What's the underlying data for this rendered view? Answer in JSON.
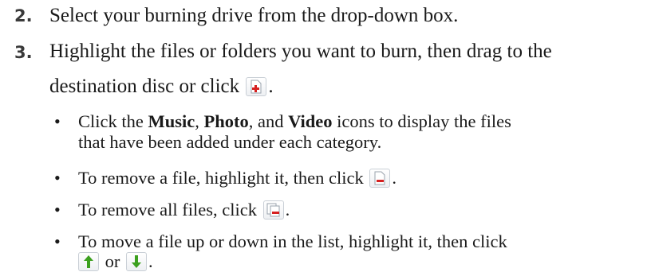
{
  "steps": [
    {
      "number": "2.",
      "text": "Select your burning drive from the drop-down box."
    },
    {
      "number": "3.",
      "line1": "Highlight the files or folders you want to burn, then drag to the",
      "line2_prefix": "destination disc or click",
      "line2_suffix": "."
    }
  ],
  "bullets": {
    "b1": {
      "prefix": "Click the ",
      "music": "Music",
      "sep1": ", ",
      "photo": "Photo",
      "sep2": ", and ",
      "video": "Video",
      "suffix": " icons to display the files",
      "line2": "that have been added under each category."
    },
    "b2": {
      "text": "To remove a file, highlight it, then click",
      "suffix": "."
    },
    "b3": {
      "text": "To remove all files, click",
      "suffix": "."
    },
    "b4": {
      "line1": "To move a file up or down in the list, highlight it, then click",
      "or": "or",
      "suffix": "."
    }
  },
  "bullet_symbol": "•",
  "icons": {
    "add": "add-file-icon",
    "remove": "remove-file-icon",
    "remove_all": "remove-all-files-icon",
    "up": "move-up-icon",
    "down": "move-down-icon"
  },
  "colors": {
    "add_red": "#d62020",
    "arrow_green": "#3ca01e"
  }
}
